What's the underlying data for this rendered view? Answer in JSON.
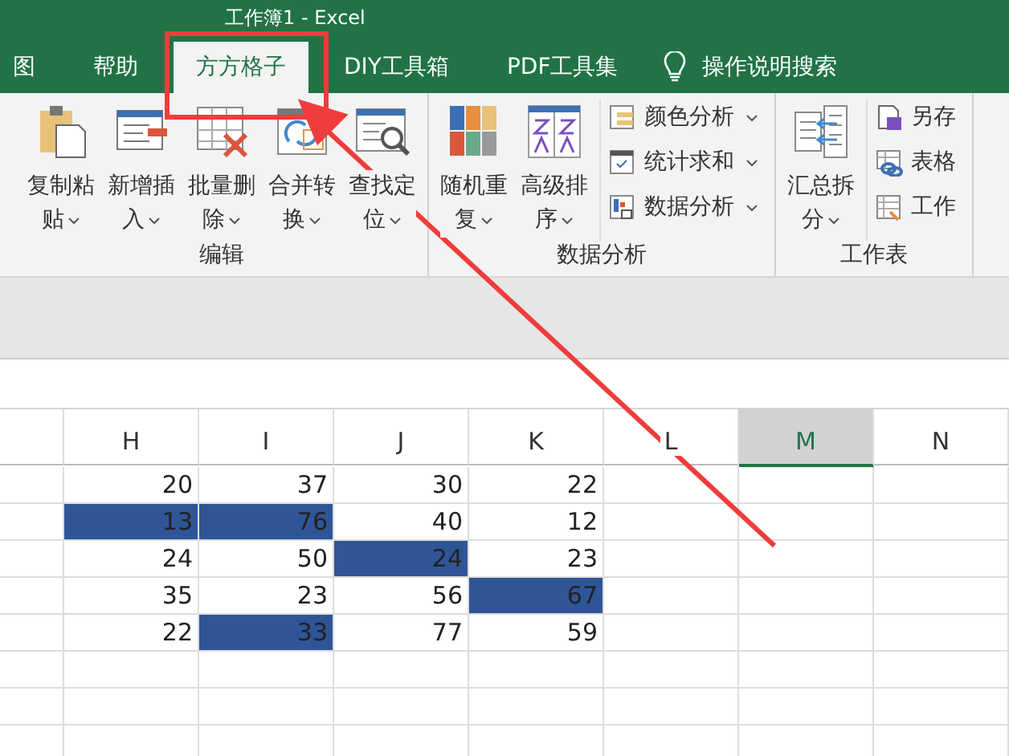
{
  "window": {
    "title": "工作簿1 - Excel"
  },
  "tabs": [
    {
      "label": "图",
      "selected": false
    },
    {
      "label": "帮助",
      "selected": false
    },
    {
      "label": "方方格子",
      "selected": true
    },
    {
      "label": "DIY工具箱",
      "selected": false
    },
    {
      "label": "PDF工具集",
      "selected": false
    }
  ],
  "search": {
    "label": "操作说明搜索"
  },
  "ribbon": {
    "groups": [
      {
        "label": "编辑",
        "items": [
          {
            "kind": "large",
            "label": "复制粘贴",
            "dropdown": true
          },
          {
            "kind": "large",
            "label": "新增插入",
            "dropdown": true
          },
          {
            "kind": "large",
            "label": "批量删除",
            "dropdown": true
          },
          {
            "kind": "large",
            "label": "合并转换",
            "dropdown": true
          },
          {
            "kind": "large",
            "label": "查找定位",
            "dropdown": true
          }
        ]
      },
      {
        "label": "数据分析",
        "items": [
          {
            "kind": "large",
            "label": "随机重复",
            "dropdown": true
          },
          {
            "kind": "large",
            "label": "高级排序",
            "dropdown": true
          },
          {
            "kind": "small",
            "label": "颜色分析",
            "dropdown": true
          },
          {
            "kind": "small",
            "label": "统计求和",
            "dropdown": true
          },
          {
            "kind": "small",
            "label": "数据分析",
            "dropdown": true
          }
        ]
      },
      {
        "label": "工作表",
        "items": [
          {
            "kind": "large",
            "label": "汇总拆分",
            "dropdown": true
          },
          {
            "kind": "small",
            "label": "另存",
            "dropdown": false
          },
          {
            "kind": "small",
            "label": "表格",
            "dropdown": false
          },
          {
            "kind": "small",
            "label": "工作",
            "dropdown": false
          }
        ]
      }
    ]
  },
  "sheet": {
    "columns": [
      {
        "label": "H",
        "selected": false
      },
      {
        "label": "I",
        "selected": false
      },
      {
        "label": "J",
        "selected": false
      },
      {
        "label": "K",
        "selected": false
      },
      {
        "label": "L",
        "selected": false
      },
      {
        "label": "M",
        "selected": true
      },
      {
        "label": "N",
        "selected": false
      }
    ],
    "rows": [
      {
        "cells": [
          {
            "text": "20",
            "selected": false
          },
          {
            "text": "37",
            "selected": false
          },
          {
            "text": "30",
            "selected": false
          },
          {
            "text": "22",
            "selected": false
          }
        ]
      },
      {
        "cells": [
          {
            "text": "13",
            "selected": true
          },
          {
            "text": "76",
            "selected": true
          },
          {
            "text": "40",
            "selected": false
          },
          {
            "text": "12",
            "selected": false
          }
        ]
      },
      {
        "cells": [
          {
            "text": "24",
            "selected": false
          },
          {
            "text": "50",
            "selected": false
          },
          {
            "text": "24",
            "selected": true
          },
          {
            "text": "23",
            "selected": false
          }
        ]
      },
      {
        "cells": [
          {
            "text": "35",
            "selected": false
          },
          {
            "text": "23",
            "selected": false
          },
          {
            "text": "56",
            "selected": false
          },
          {
            "text": "67",
            "selected": true
          }
        ]
      },
      {
        "cells": [
          {
            "text": "22",
            "selected": false
          },
          {
            "text": "33",
            "selected": true
          },
          {
            "text": "77",
            "selected": false
          },
          {
            "text": "59",
            "selected": false
          }
        ]
      }
    ]
  }
}
